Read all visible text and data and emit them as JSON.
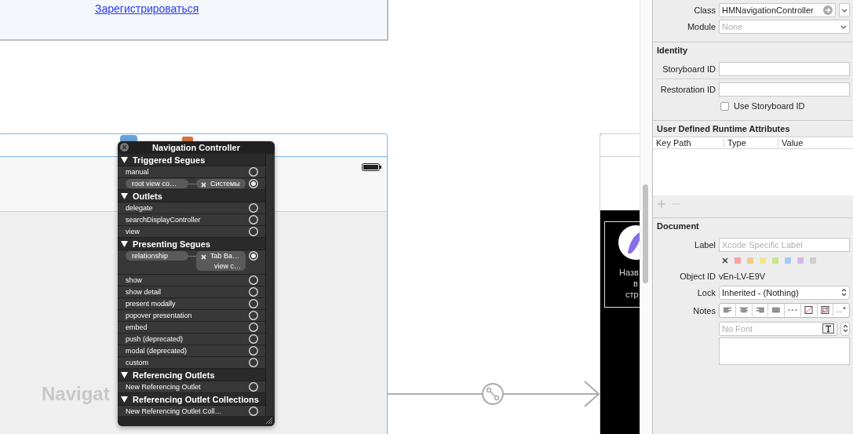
{
  "canvas": {
    "login_scene": {
      "link": "Зарегистрироваться"
    },
    "nav_scene": {
      "title": "Navigat"
    },
    "connections_popup": {
      "title": "Navigation Controller",
      "sections": [
        {
          "title": "Triggered Segues",
          "expanded": true,
          "items": [
            {
              "name": "manual",
              "connected": false
            },
            {
              "name": "root view co…",
              "connected": true,
              "target": [
                "Системы"
              ]
            }
          ]
        },
        {
          "title": "Outlets",
          "expanded": true,
          "items": [
            {
              "name": "delegate",
              "connected": false
            },
            {
              "name": "searchDisplayController",
              "connected": false
            },
            {
              "name": "view",
              "connected": false
            }
          ]
        },
        {
          "title": "Presenting Segues",
          "expanded": true,
          "items": [
            {
              "name": "relationship",
              "connected": true,
              "target": [
                "Tab Ba…",
                "view c…"
              ]
            },
            {
              "name": "show",
              "connected": false
            },
            {
              "name": "show detail",
              "connected": false
            },
            {
              "name": "present modally",
              "connected": false
            },
            {
              "name": "popover presentation",
              "connected": false
            },
            {
              "name": "embed",
              "connected": false
            },
            {
              "name": "push (deprecated)",
              "connected": false
            },
            {
              "name": "modal (deprecated)",
              "connected": false
            },
            {
              "name": "custom",
              "connected": false
            }
          ]
        },
        {
          "title": "Referencing Outlets",
          "expanded": true,
          "items": [
            {
              "name": "New Referencing Outlet",
              "connected": false
            }
          ]
        },
        {
          "title": "Referencing Outlet Collections",
          "expanded": true,
          "items": [
            {
              "name": "New Referencing Outlet Coll…",
              "connected": false
            }
          ]
        }
      ]
    },
    "next_scene": {
      "lines": [
        "Назв",
        "в",
        "стр"
      ]
    }
  },
  "inspector": {
    "class": {
      "label": "Class",
      "value": "HMNavigationController"
    },
    "module": {
      "label": "Module",
      "placeholder": "None"
    },
    "identity": {
      "title": "Identity",
      "storyboard_id": {
        "label": "Storyboard ID"
      },
      "restoration_id": {
        "label": "Restoration ID"
      },
      "use_storyboard_id": {
        "label": "Use Storyboard ID",
        "checked": false
      }
    },
    "runtime_attributes": {
      "title": "User Defined Runtime Attributes",
      "columns": [
        "Key Path",
        "Type",
        "Value"
      ]
    },
    "document": {
      "title": "Document",
      "label": {
        "label": "Label",
        "placeholder": "Xcode Specific Label"
      },
      "colors": [
        {
          "color": "#f7a3a3"
        },
        {
          "color": "#f8c98d"
        },
        {
          "color": "#f4e98a"
        },
        {
          "color": "#cbe28e"
        },
        {
          "color": "#a0ccf4"
        },
        {
          "color": "#d8b6ea"
        },
        {
          "color": "#cfcfcf"
        }
      ],
      "object_id": {
        "label": "Object ID",
        "value": "vEn-LV-E9V"
      },
      "lock": {
        "label": "Lock",
        "value": "Inherited - (Nothing)"
      },
      "notes": {
        "label": "Notes",
        "font_placeholder": "No Font"
      }
    }
  }
}
